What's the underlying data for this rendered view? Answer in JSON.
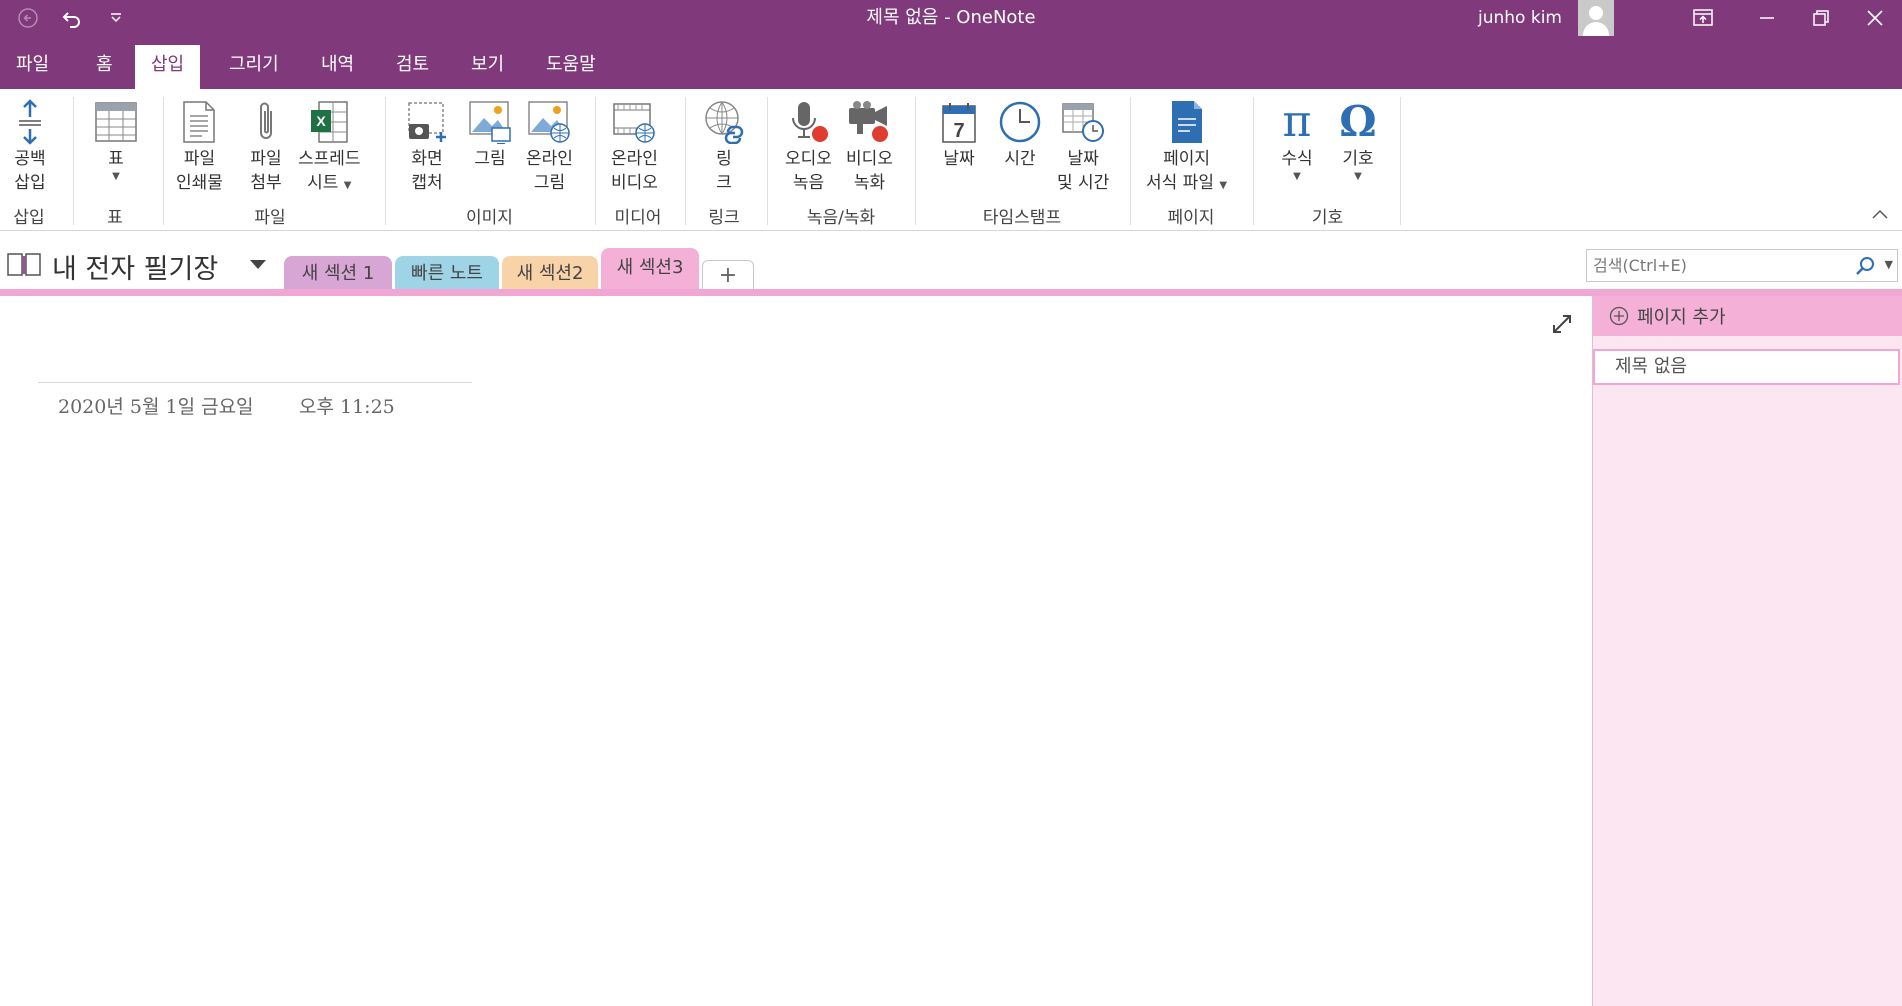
{
  "window": {
    "title": "제목 없음  -  OneNote",
    "user": "junho kim"
  },
  "menu": {
    "tabs": [
      "파일",
      "홈",
      "삽입",
      "그리기",
      "내역",
      "검토",
      "보기",
      "도움말"
    ],
    "active": "삽입"
  },
  "ribbon": {
    "buttons": {
      "space_insert": [
        "공백",
        "삽입"
      ],
      "table": [
        "표"
      ],
      "file_printout": [
        "파일",
        "인쇄물"
      ],
      "file_attach": [
        "파일",
        "첨부"
      ],
      "spreadsheet": [
        "스프레드",
        "시트"
      ],
      "screen_clip": [
        "화면",
        "캡처"
      ],
      "picture": [
        "그림"
      ],
      "online_picture": [
        "온라인",
        "그림"
      ],
      "online_video": [
        "온라인",
        "비디오"
      ],
      "link": [
        "링",
        "크"
      ],
      "audio_record": [
        "오디오",
        "녹음"
      ],
      "video_record": [
        "비디오",
        "녹화"
      ],
      "date": [
        "날짜"
      ],
      "time": [
        "시간"
      ],
      "date_time": [
        "날짜",
        "및 시간"
      ],
      "page_template": [
        "페이지",
        "서식 파일"
      ],
      "equation": [
        "수식"
      ],
      "symbol": [
        "기호"
      ]
    },
    "groups": {
      "insert": "삽입",
      "table": "표",
      "files": "파일",
      "images": "이미지",
      "media": "미디어",
      "links": "링크",
      "recording": "녹음/녹화",
      "timestamp": "타임스탬프",
      "pages": "페이지",
      "symbols": "기호"
    },
    "icon_glyphs": {
      "pi": "π",
      "omega": "Ω",
      "calendar_day": "7"
    }
  },
  "notebook": {
    "title": "내 전자 필기장",
    "sections": [
      {
        "label": "새 섹션 1",
        "color": "#d7a6d5"
      },
      {
        "label": "빠른 노트",
        "color": "#9fd3e6"
      },
      {
        "label": "새 섹션2",
        "color": "#f8d3a8"
      },
      {
        "label": "새 섹션3",
        "color": "#f4b0d6"
      }
    ],
    "add_section": "+"
  },
  "search": {
    "placeholder": "검색(Ctrl+E)"
  },
  "page": {
    "date": "2020년 5월 1일 금요일",
    "time": "오후 11:25"
  },
  "pages_panel": {
    "add_page": "페이지 추가",
    "pages": [
      "제목 없음"
    ]
  },
  "colors": {
    "accent": "#80397b",
    "section_pink": "#f4b0d6",
    "panel_bg": "#fbe6f2",
    "icon_blue": "#2e6fb3",
    "excel_green": "#1e7145",
    "record_red": "#e03c31"
  }
}
